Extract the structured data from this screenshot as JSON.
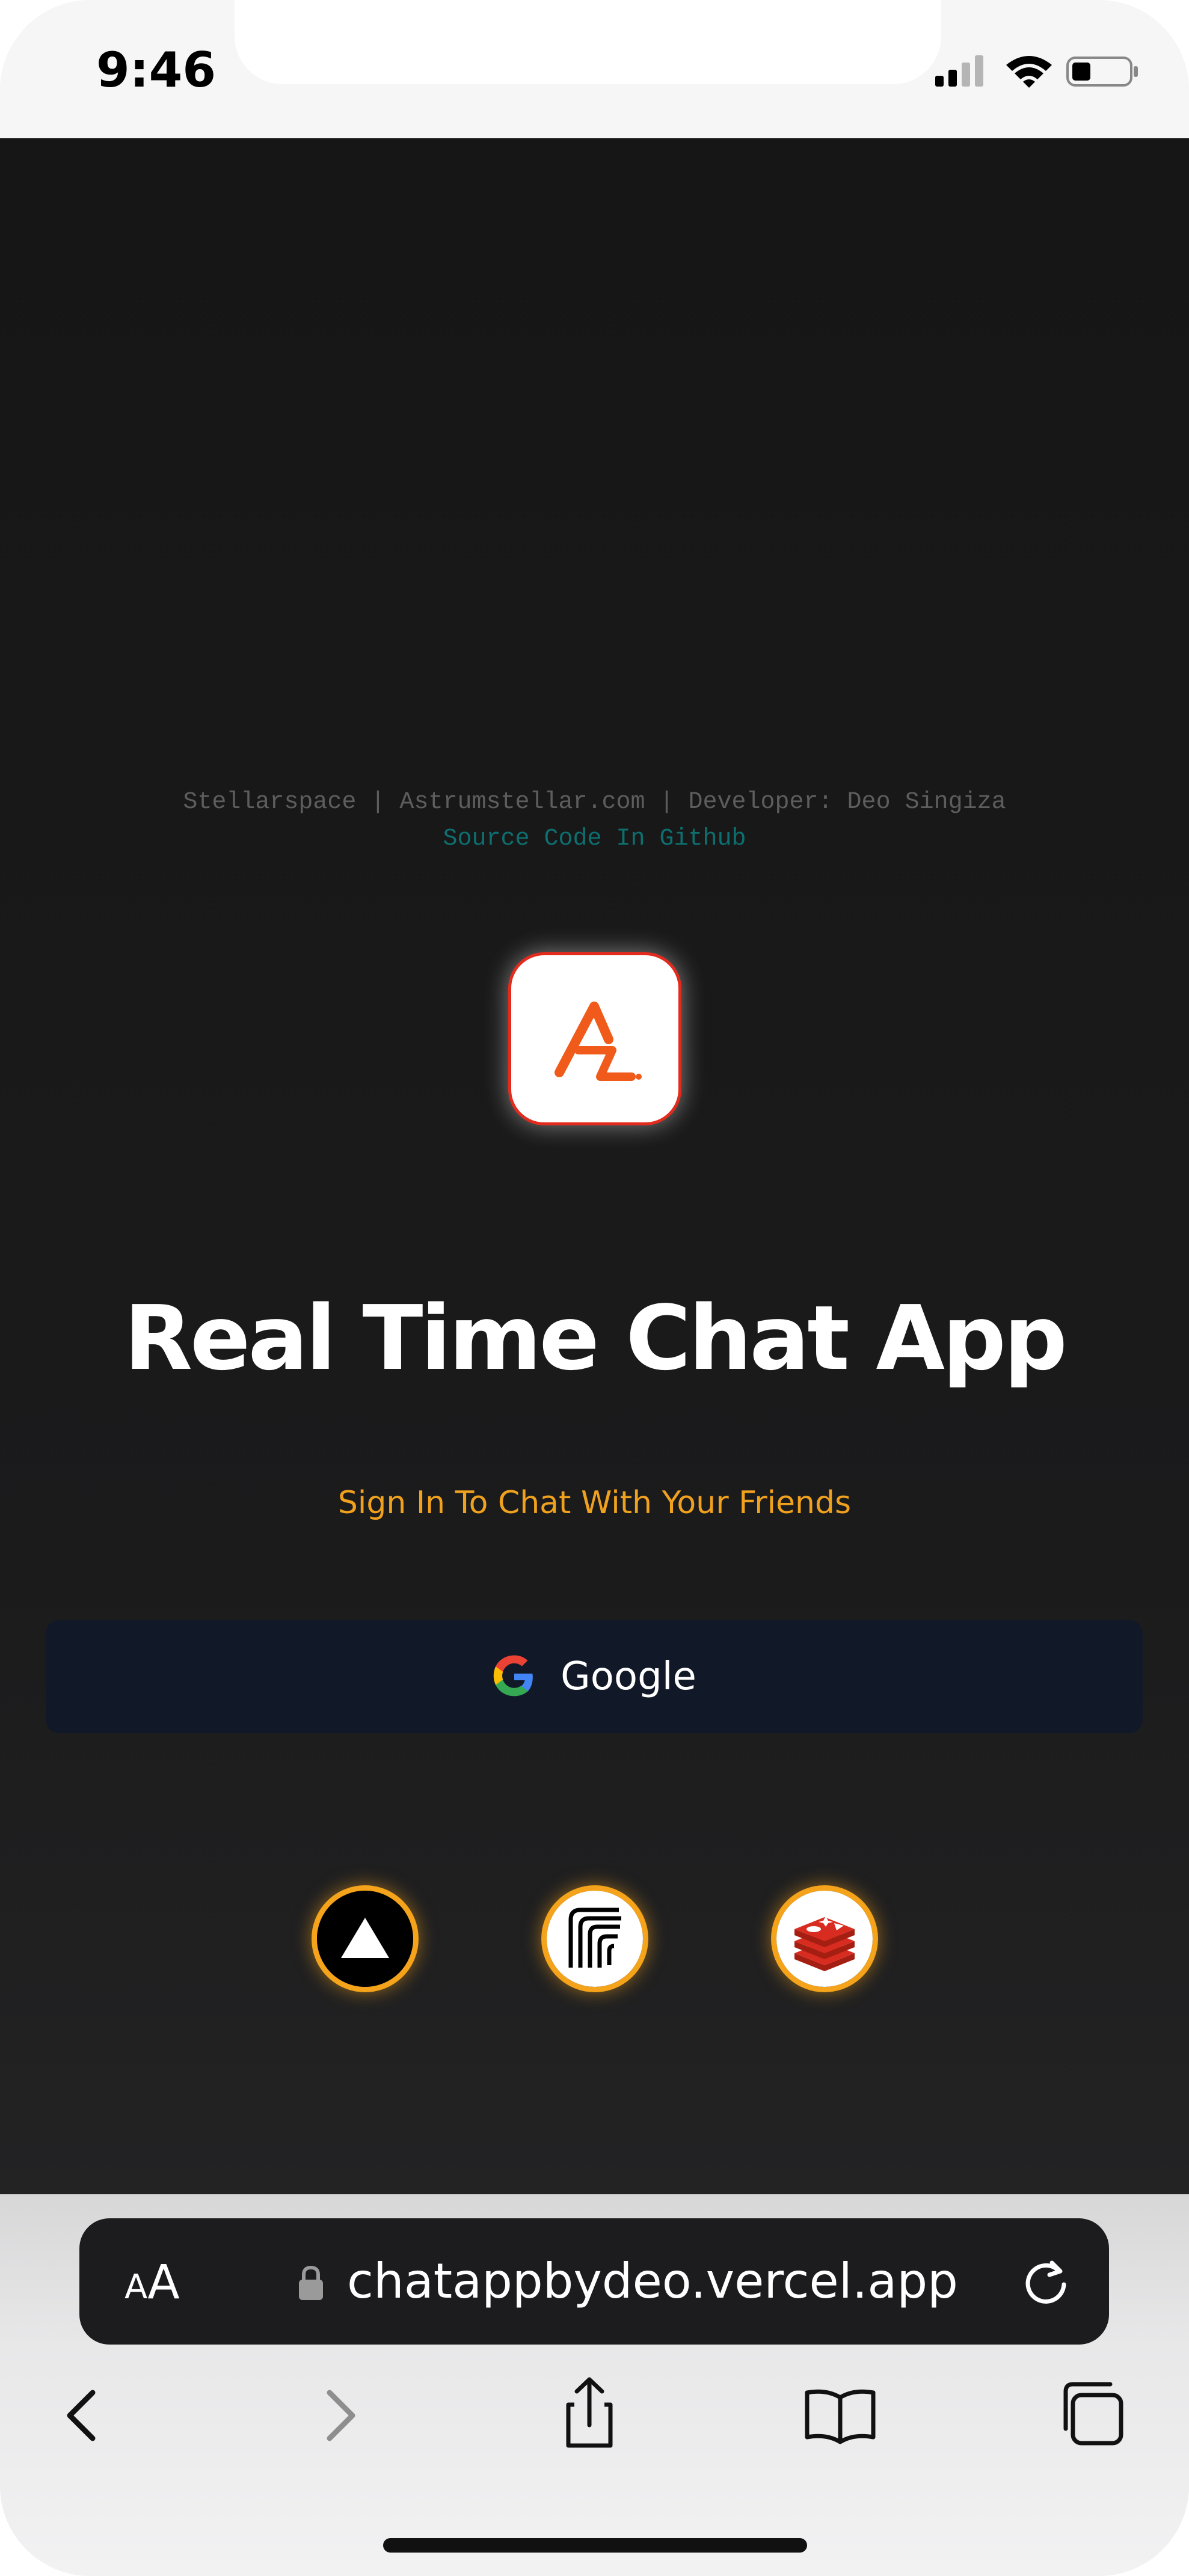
{
  "status_bar": {
    "time": "9:46"
  },
  "page": {
    "credits": "Stellarspace | Astrumstellar.com | Developer: Deo Singiza",
    "source_link": "Source Code In Github",
    "title": "Real Time Chat App",
    "subtitle": "Sign In To Chat With Your Friends",
    "google_button_label": "Google",
    "tech_icons": [
      "nextjs-icon",
      "upstash-icon",
      "redis-icon"
    ],
    "colors": {
      "accent": "#f0a11e",
      "button_bg": "#111827",
      "logo_border": "#e32b1d",
      "link": "#0d6f6f"
    }
  },
  "browser": {
    "text_size_label_small": "A",
    "text_size_label_large": "A",
    "url": "chatappbydeo.vercel.app",
    "nav": [
      "back-icon",
      "forward-icon",
      "share-icon",
      "bookmarks-icon",
      "tabs-icon"
    ]
  }
}
